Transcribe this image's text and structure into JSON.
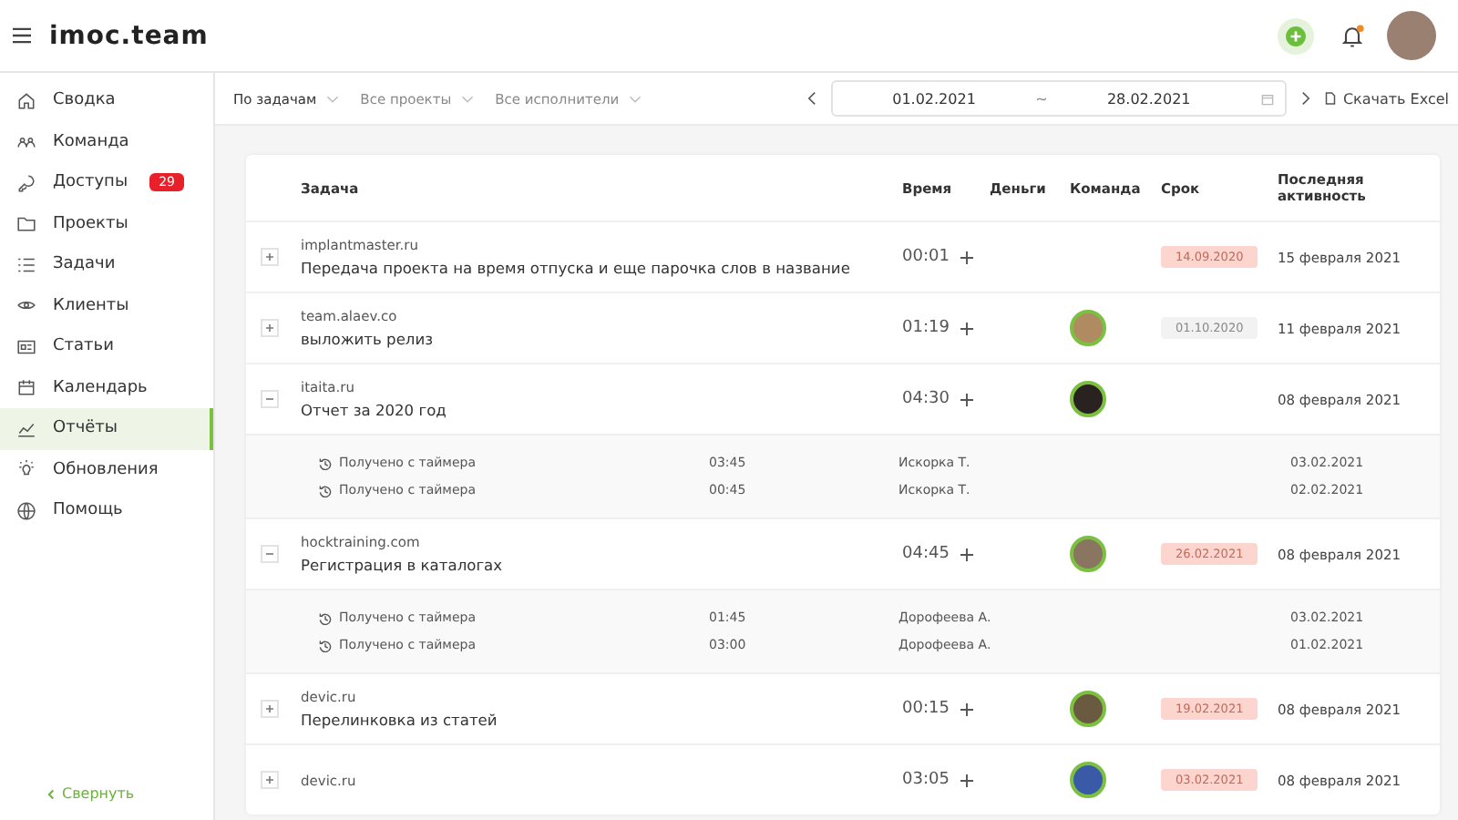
{
  "logo": "imoc.team",
  "sidebar": {
    "items": [
      {
        "label": "Сводка",
        "selected": false
      },
      {
        "label": "Команда",
        "selected": false
      },
      {
        "label": "Доступы",
        "selected": false,
        "badge": "29"
      },
      {
        "label": "Проекты",
        "selected": false
      },
      {
        "label": "Задачи",
        "selected": false
      },
      {
        "label": "Клиенты",
        "selected": false
      },
      {
        "label": "Статьи",
        "selected": false
      },
      {
        "label": "Календарь",
        "selected": false
      },
      {
        "label": "Отчёты",
        "selected": true
      },
      {
        "label": "Обновления",
        "selected": false
      },
      {
        "label": "Помощь",
        "selected": false
      }
    ],
    "collapse": "Свернуть"
  },
  "filters": [
    "По задачам",
    "Все проекты",
    "Все исполнители"
  ],
  "date_range": {
    "from": "01.02.2021",
    "separator": "~",
    "to": "28.02.2021"
  },
  "export": "Скачать Excel",
  "table": {
    "columns": [
      "Задача",
      "Время",
      "Деньги",
      "Команда",
      "Срок",
      "Последняя активность"
    ],
    "rows": [
      {
        "client": "implantmaster.ru",
        "title": "Передача проекта на время отпуска и еще парочка слов в название",
        "time": "00:01",
        "avatar": null,
        "deadline": {
          "text": "14.09.2020",
          "overdue": true
        },
        "activity": "15 февраля 2021",
        "expanded": false,
        "entries": []
      },
      {
        "client": "team.alaev.co",
        "title": "выложить релиз",
        "time": "01:19",
        "avatar": {
          "color": "#b08a60"
        },
        "deadline": {
          "text": "01.10.2020",
          "overdue": false
        },
        "activity": "11 февраля 2021",
        "expanded": false,
        "entries": []
      },
      {
        "client": "itaita.ru",
        "title": "Отчет за 2020 год",
        "time": "04:30",
        "avatar": {
          "color": "#2a2220"
        },
        "deadline": null,
        "activity": "08 февраля 2021",
        "expanded": true,
        "entries": [
          {
            "label": "Получено с таймера",
            "time": "03:45",
            "person": "Искорка Т.",
            "date": "03.02.2021"
          },
          {
            "label": "Получено с таймера",
            "time": "00:45",
            "person": "Искорка Т.",
            "date": "02.02.2021"
          }
        ]
      },
      {
        "client": "hocktraining.com",
        "title": "Регистрация в каталогах",
        "time": "04:45",
        "avatar": {
          "color": "#8a7560"
        },
        "deadline": {
          "text": "26.02.2021",
          "overdue": true
        },
        "activity": "08 февраля 2021",
        "expanded": true,
        "entries": [
          {
            "label": "Получено с таймера",
            "time": "01:45",
            "person": "Дорофеева А.",
            "date": "03.02.2021"
          },
          {
            "label": "Получено с таймера",
            "time": "03:00",
            "person": "Дорофеева А.",
            "date": "01.02.2021"
          }
        ]
      },
      {
        "client": "devic.ru",
        "title": "Перелинковка из статей",
        "time": "00:15",
        "avatar": {
          "color": "#6a5a40"
        },
        "deadline": {
          "text": "19.02.2021",
          "overdue": true
        },
        "activity": "08 февраля 2021",
        "expanded": false,
        "entries": []
      },
      {
        "client": "devic.ru",
        "title": null,
        "time": "03:05",
        "avatar": {
          "color": "#3a5aa8"
        },
        "deadline": {
          "text": "03.02.2021",
          "overdue": true
        },
        "activity": "08 февраля 2021",
        "expanded": false,
        "entries": []
      }
    ]
  }
}
